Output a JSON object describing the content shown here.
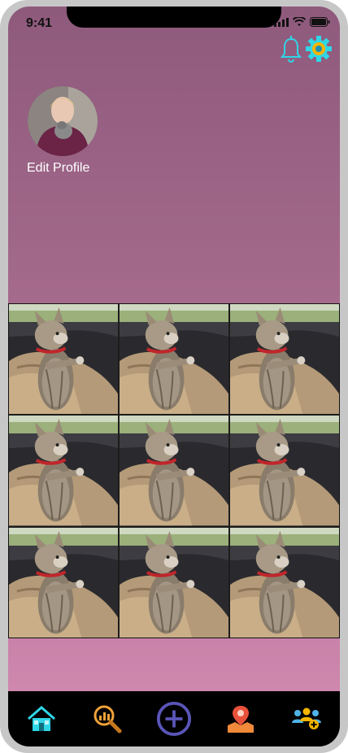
{
  "status_bar": {
    "time": "9:41"
  },
  "header": {
    "notification_icon": "bell-icon",
    "settings_icon": "gear-icon"
  },
  "profile": {
    "edit_label": "Edit Profile"
  },
  "gallery": {
    "items": [
      "kitten photo",
      "kitten photo",
      "kitten photo",
      "kitten photo",
      "kitten photo",
      "kitten photo",
      "kitten photo",
      "kitten photo",
      "kitten photo"
    ]
  },
  "tab_bar": {
    "tabs": [
      {
        "icon": "home-icon"
      },
      {
        "icon": "search-analytics-icon"
      },
      {
        "icon": "add-icon"
      },
      {
        "icon": "map-pin-icon"
      },
      {
        "icon": "add-friends-icon"
      }
    ]
  },
  "colors": {
    "accent_cyan": "#2fd6e6",
    "add_button": "#5a55b8",
    "search_orange": "#f0a33a",
    "pin_red": "#e8513a"
  }
}
